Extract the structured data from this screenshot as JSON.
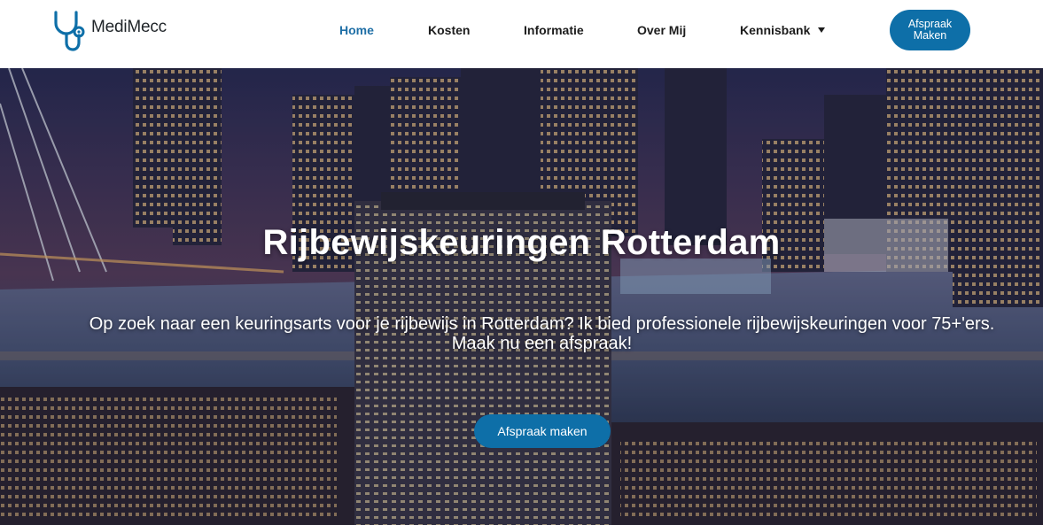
{
  "brand": {
    "name": "MediMecc",
    "accent": "#0e6fa8",
    "icon": "stethoscope-icon"
  },
  "nav": {
    "items": [
      {
        "label": "Home",
        "active": true
      },
      {
        "label": "Kosten",
        "active": false
      },
      {
        "label": "Informatie",
        "active": false
      },
      {
        "label": "Over Mij",
        "active": false
      },
      {
        "label": "Kennisbank",
        "active": false,
        "has_dropdown": true
      }
    ],
    "cta_label": "Afspraak Maken"
  },
  "hero": {
    "title": "Rijbewijskeuringen Rotterdam",
    "subtitle": "Op zoek naar een keuringsarts voor je rijbewijs in Rotterdam? Ik bied professionele rijbewijskeuringen voor 75+'ers. Maak nu een afspraak!",
    "cta_label": "Afspraak maken",
    "background": "rotterdam-night-skyline-image"
  }
}
